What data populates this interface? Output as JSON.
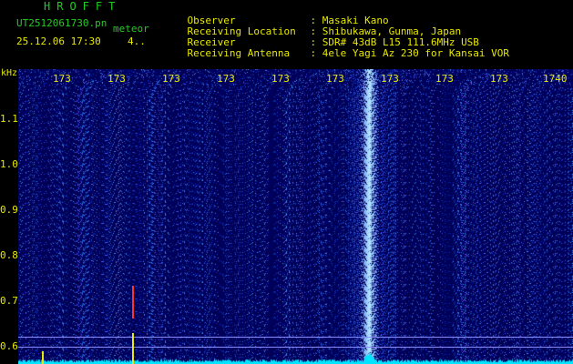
{
  "header": {
    "title": "HROFFT",
    "filename": "UT2512061730.pn",
    "mode": "meteor",
    "datetime": "25.12.06 17:30",
    "count": "4..",
    "info": [
      {
        "label": "Observer",
        "value": ": Masaki Kano"
      },
      {
        "label": "Receiving Location",
        "value": ": Shibukawa, Gunma, Japan"
      },
      {
        "label": "Receiver",
        "value": ": SDR# 43dB L15 111.6MHz USB"
      },
      {
        "label": "Receiving Antenna",
        "value": ": 4ele Yagi Az 230 for Kansai VOR"
      }
    ]
  },
  "axis": {
    "unit": "kHz",
    "x_ticks": [
      "173",
      "173",
      "173",
      "173",
      "173",
      "173",
      "173",
      "173",
      "173",
      "1740"
    ],
    "y_ticks": [
      "1.1",
      "1.0",
      "0.9",
      "0.8",
      "0.7",
      "0.6"
    ]
  },
  "colors": {
    "background": "#000000",
    "plot_bg": "#00005a",
    "text_yellow": "#e8e800",
    "text_green": "#22cc22",
    "signal": "#4f7dff",
    "spectrum": "#00e5ff"
  }
}
